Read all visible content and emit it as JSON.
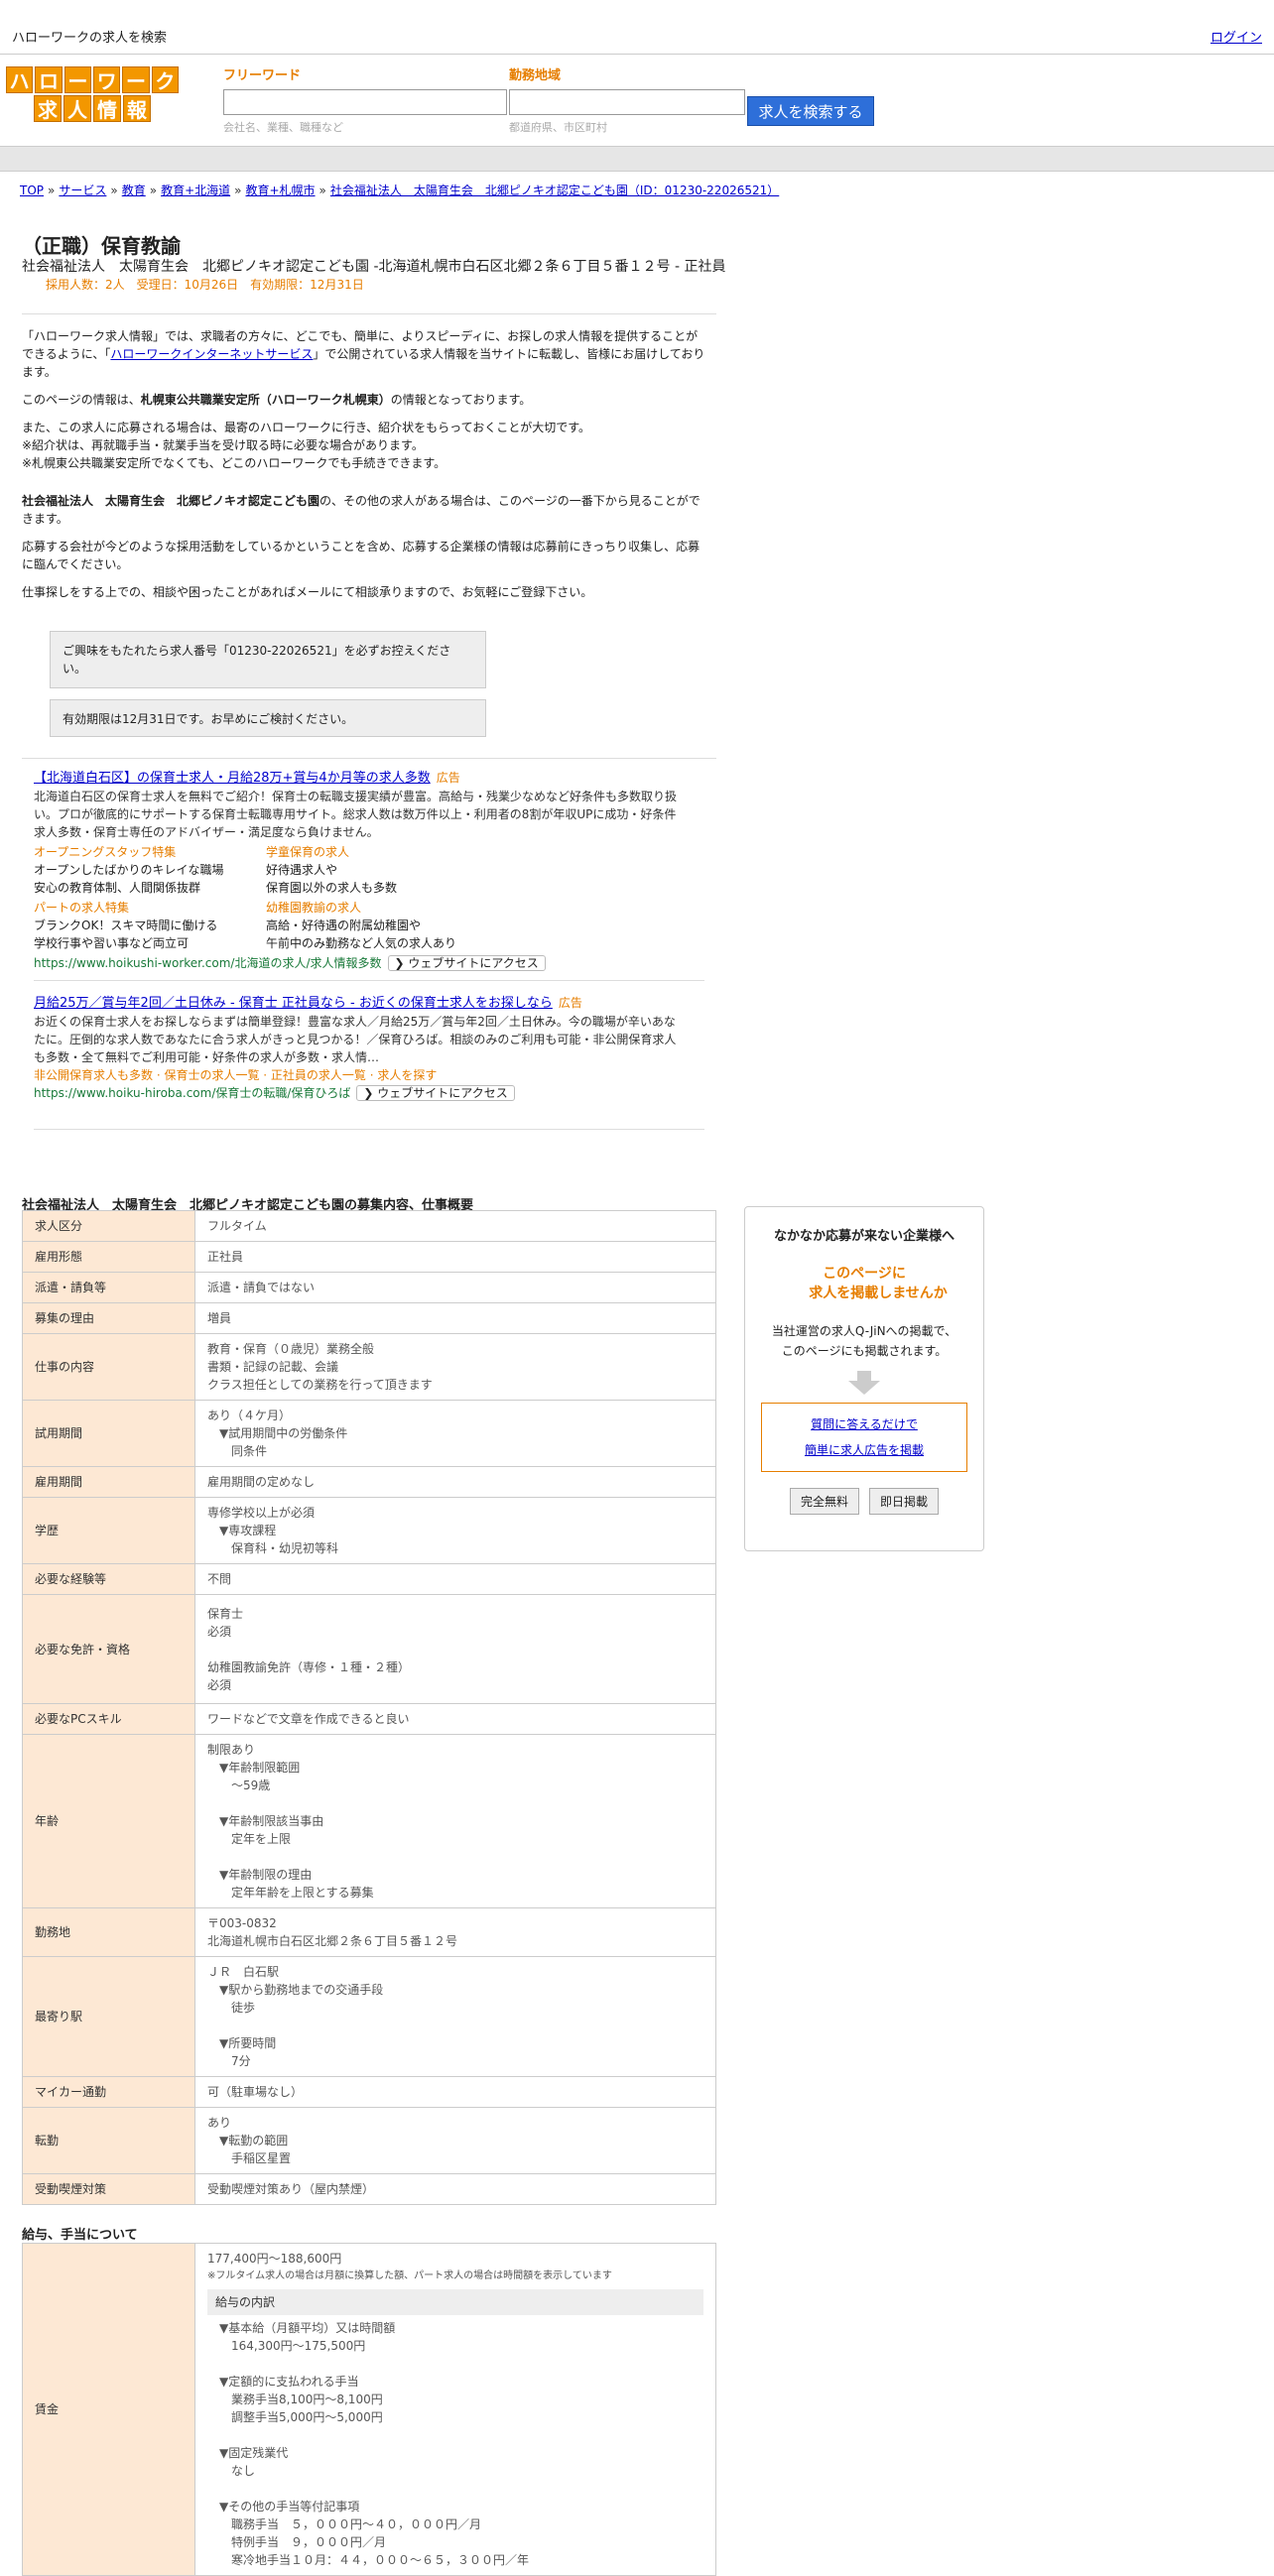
{
  "topbar": {
    "site_title": "ハローワークの求人を検索",
    "login": "ログイン"
  },
  "logo": {
    "row1": [
      "ハ",
      "ロ",
      "ー",
      "ワ",
      "ー",
      "ク"
    ],
    "row2": [
      "求",
      "人",
      "情",
      "報"
    ]
  },
  "search": {
    "freeword_label": "フリーワード",
    "freeword_hint": "会社名、業種、職種など",
    "area_label": "勤務地域",
    "area_hint": "都道府県、市区町村",
    "button": "求人を検索する"
  },
  "breadcrumb": [
    "TOP",
    "サービス",
    "教育",
    "教育+北海道",
    "教育+札幌市",
    "社会福祉法人　太陽育生会　北郷ピノキオ認定こども園（ID：01230-22026521）"
  ],
  "job": {
    "title": "（正職）保育教諭",
    "subtitle": "社会福祉法人　太陽育生会　北郷ピノキオ認定こども園 -北海道札幌市白石区北郷２条６丁目５番１２号 - 正社員",
    "meta": "採用人数：2人　受理日：10月26日　有効期限：12月31日"
  },
  "intro": {
    "p1a": "「ハローワーク求人情報」では、求職者の方々に、どこでも、簡単に、よりスピーディに、お探しの求人情報を提供することができるように、「",
    "p1link": "ハローワークインターネットサービス",
    "p1b": "」で公開されている求人情報を当サイトに転載し、皆様にお届けしております。",
    "p2a": "このページの情報は、",
    "p2b": "札幌東公共職業安定所（ハローワーク札幌東）",
    "p2c": "の情報となっております。",
    "p3": "また、この求人に応募される場合は、最寄のハローワークに行き、紹介状をもらっておくことが大切です。",
    "p3b": "※紹介状は、再就職手当・就業手当を受け取る時に必要な場合があります。",
    "p3c": "※札幌東公共職業安定所でなくても、どこのハローワークでも手続きできます。",
    "p4a": "社会福祉法人　太陽育生会　北郷ピノキオ認定こども園",
    "p4b": "の、その他の求人がある場合は、このページの一番下から見ることができます。",
    "p5": "応募する会社が今どのような採用活動をしているかということを含め、応募する企業様の情報は応募前にきっちり収集し、応募に臨んでください。",
    "p6": "仕事探しをする上での、相談や困ったことがあればメールにて相談承りますので、お気軽にご登録下さい。"
  },
  "notes": {
    "n1": "ご興味をもたれたら求人番号「01230-22026521」を必ずお控えください。",
    "n2": "有効期限は12月31日です。お早めにご検討ください。"
  },
  "ads": [
    {
      "title": "【北海道白石区】の保育士求人・月給28万+賞与4か月等の求人多数",
      "badge": "広告",
      "text": "北海道白石区の保育士求人を無料でご紹介！保育士の転職支援実績が豊富。高給与・残業少なめなど好条件も多数取り扱い。プロが徹底的にサポートする保育士転職専用サイト。総求人数は数万件以上・利用者の8割が年収UPに成功・好条件求人多数・保育士専任のアドバイザー・満足度なら負けません。",
      "cols": [
        {
          "head": "オープニングスタッフ特集",
          "l1": "オープンしたばかりのキレイな職場",
          "l2": "安心の教育体制、人間関係抜群"
        },
        {
          "head": "学童保育の求人",
          "l1": "好待遇求人や",
          "l2": "保育園以外の求人も多数"
        }
      ],
      "cols2": [
        {
          "head": "パートの求人特集",
          "l1": "ブランクOK！スキマ時間に働ける",
          "l2": "学校行事や習い事など両立可"
        },
        {
          "head": "幼稚園教諭の求人",
          "l1": "高給・好待遇の附属幼稚園や",
          "l2": "午前中のみ勤務など人気の求人あり"
        }
      ],
      "url": "https://www.hoikushi-worker.com/北海道の求人/求人情報多数",
      "access": "ウェブサイトにアクセス"
    },
    {
      "title": "月給25万／賞与年2回／土日休み - 保育士 正社員なら - お近くの保育士求人をお探しなら",
      "badge": "広告",
      "text": "お近くの保育士求人をお探しならまずは簡単登録！豊富な求人／月給25万／賞与年2回／土日休み。今の職場が辛いあなたに。圧倒的な求人数であなたに合う求人がきっと見つかる！／保育ひろば。相談のみのご利用も可能・非公開保育求人も多数・全て無料でご利用可能・好条件の求人が多数・求人情…",
      "links": "非公開保育求人も多数 · 保育士の求人一覧 · 正社員の求人一覧 · 求人を探す",
      "url": "https://www.hoiku-hiroba.com/保育士の転職/保育ひろば",
      "access": "ウェブサイトにアクセス"
    }
  ],
  "section_title": "社会福祉法人　太陽育生会　北郷ピノキオ認定こども園の募集内容、仕事概要",
  "rows": [
    {
      "label": "求人区分",
      "lines": [
        "フルタイム"
      ]
    },
    {
      "label": "雇用形態",
      "lines": [
        "正社員"
      ]
    },
    {
      "label": "派遣・請負等",
      "lines": [
        "派遣・請負ではない"
      ]
    },
    {
      "label": "募集の理由",
      "lines": [
        "増員"
      ]
    },
    {
      "label": "仕事の内容",
      "lines": [
        "教育・保育（０歳児）業務全般",
        "書類・記録の記載、会議",
        "クラス担任としての業務を行って頂きます"
      ]
    },
    {
      "label": "試用期間",
      "lines": [
        "あり（４ケ月）",
        "　▼試用期間中の労働条件",
        "　　同条件"
      ]
    },
    {
      "label": "雇用期間",
      "lines": [
        "雇用期間の定めなし"
      ]
    },
    {
      "label": "学歴",
      "lines": [
        "専修学校以上が必須",
        "　▼専攻課程",
        "　　保育科・幼児初等科"
      ]
    },
    {
      "label": "必要な経験等",
      "lines": [
        "不問"
      ]
    },
    {
      "label": "必要な免許・資格",
      "lines": [
        "保育士",
        "必須",
        "",
        "幼稚園教諭免許（専修・１種・２種）",
        "必須"
      ]
    },
    {
      "label": "必要なPCスキル",
      "lines": [
        "ワードなどで文章を作成できると良い"
      ]
    },
    {
      "label": "年齢",
      "lines": [
        "制限あり",
        "　▼年齢制限範囲",
        "　　〜59歳",
        "",
        "　▼年齢制限該当事由",
        "　　定年を上限",
        "",
        "　▼年齢制限の理由",
        "　　定年年齢を上限とする募集"
      ]
    },
    {
      "label": "勤務地",
      "lines": [
        "〒003-0832",
        "北海道札幌市白石区北郷２条６丁目５番１２号"
      ]
    },
    {
      "label": "最寄り駅",
      "lines": [
        "ＪＲ　白石駅",
        "　▼駅から勤務地までの交通手段",
        "　　徒歩",
        "",
        "　▼所要時間",
        "　　7分"
      ]
    },
    {
      "label": "マイカー通勤",
      "lines": [
        "可（駐車場なし）"
      ]
    },
    {
      "label": "転勤",
      "lines": [
        "あり",
        "　▼転勤の範囲",
        "　　手稲区星置"
      ]
    },
    {
      "label": "受動喫煙対策",
      "lines": [
        "受動喫煙対策あり（屋内禁煙）"
      ]
    }
  ],
  "salary": {
    "title": "給与、手当について",
    "label": "賃金",
    "range": "177,400円〜188,600円",
    "note": "※フルタイム求人の場合は月額に換算した額、パート求人の場合は時間額を表示しています",
    "breakdown_head": "給与の内訳",
    "lines": [
      "▼基本給（月額平均）又は時間額",
      "　164,300円〜175,500円",
      "",
      "▼定額的に支払われる手当",
      "　業務手当8,100円〜8,100円",
      "　調整手当5,000円〜5,000円",
      "",
      "▼固定残業代",
      "　なし",
      "",
      "▼その他の手当等付記事項",
      "　職務手当　５，０００円〜４０，０００円／月",
      "　特例手当　９，０００円／月",
      "　寒冷地手当１０月：４４，０００〜６５，３００円／年"
    ]
  },
  "sidebox": {
    "title": "なかなか応募が来ない企業様へ",
    "catch1": "このページに",
    "catch2": "求人を掲載しませんか",
    "text1": "当社運営の求人Q-JiNへの掲載で、",
    "text2": "このページにも掲載されます。",
    "link1": "質問に答えるだけで",
    "link2": "簡単に求人広告を掲載",
    "btn1": "完全無料",
    "btn2": "即日掲載"
  }
}
